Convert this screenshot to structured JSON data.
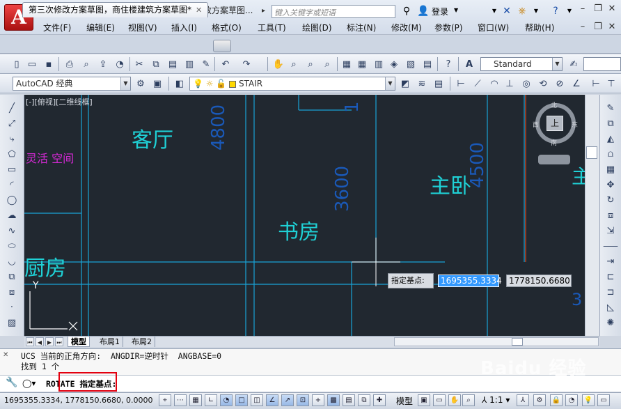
{
  "titlebar": {
    "doc_title": "第三次修改方案草图...",
    "search_placeholder": "键入关键字或短语",
    "login_label": "登录"
  },
  "menu": [
    "文件(F)",
    "编辑(E)",
    "视图(V)",
    "插入(I)",
    "格式(O)",
    "工具(T)",
    "绘图(D)",
    "标注(N)",
    "修改(M)",
    "参数(P)",
    "窗口(W)",
    "帮助(H)"
  ],
  "tab": {
    "label": "第三次修改方案草图，商住楼建筑方案草图*",
    "close": "✕"
  },
  "toolbar": {
    "text_style": "Standard",
    "workspace": "AutoCAD 经典",
    "layer_name": "STAIR"
  },
  "canvas": {
    "viewport_label": "[-][俯视][二维线框]",
    "rooms": {
      "living": "客厅",
      "master_bedroom": "主卧",
      "study": "书房",
      "kitchen": "厨房",
      "flex_space": "灵活 空间",
      "edge_char": "主"
    },
    "dimensions": {
      "d4800": "4800",
      "d3600": "3600",
      "d4500": "4500",
      "d1": "1",
      "d3": "3"
    },
    "viewcube": {
      "north": "北",
      "south": "南",
      "east": "东",
      "west": "西",
      "top": "上"
    },
    "tooltip": {
      "label": "指定基点:",
      "x_value": "1695355.3334",
      "y_value": "1778150.6680"
    },
    "ucs_y": "Y",
    "ucs_x": "X"
  },
  "layout_tabs": [
    "模型",
    "布局1",
    "布局2"
  ],
  "command": {
    "history_line1": "UCS 当前的正角方向:  ANGDIR=逆时针  ANGBASE=0",
    "history_line2": "找到 1 个",
    "prompt": "ROTATE 指定基点:"
  },
  "status": {
    "coords": "1695355.3334, 1778150.6680, 0.0000",
    "model_label": "模型",
    "scale": "1:1"
  },
  "watermark": {
    "brand": "Baidu 经验",
    "url": "jingyan.baidu.com"
  },
  "colors": {
    "canvas_bg": "#212830",
    "drawing_line": "#19a3d6",
    "text_cyan": "#1fd1d6",
    "dim_blue": "#1a59b8",
    "magenta": "#d629d6",
    "highlight_red": "#e3000f"
  }
}
